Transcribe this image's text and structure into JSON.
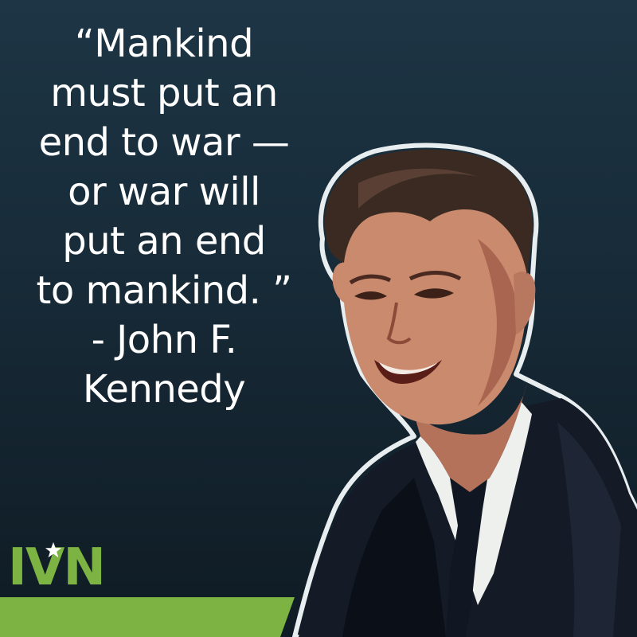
{
  "quote": {
    "lines": [
      "“Mankind",
      "must put an",
      "end to war —",
      "or war will",
      "put an end",
      "to mankind. ”",
      "- John F.",
      "Kennedy"
    ]
  },
  "logo": {
    "text": "IVN",
    "icon": "star-icon"
  },
  "colors": {
    "background_top": "#1d3545",
    "background_bottom": "#0f1b24",
    "brand_green": "#7cb342",
    "text": "#ffffff",
    "star": "#ffffff"
  }
}
